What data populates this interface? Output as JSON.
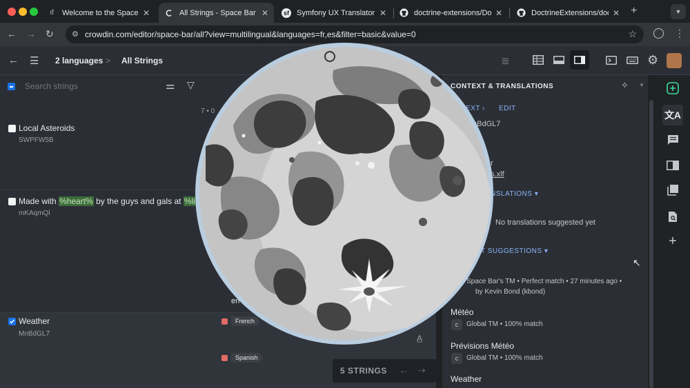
{
  "browser": {
    "tabs": [
      {
        "label": "Welcome to the SpaceBar",
        "favicon": "spacebar-logo-icon"
      },
      {
        "label": "All Strings - Space Bar - C",
        "favicon": "crowdin-icon",
        "active": true
      },
      {
        "label": "Symfony UX Translator Dc",
        "favicon": "symfony-icon"
      },
      {
        "label": "doctrine-extensions/Doct",
        "favicon": "github-icon"
      },
      {
        "label": "DoctrineExtensions/doc/t",
        "favicon": "github-icon"
      }
    ],
    "url": "crowdin.com/editor/space-bar/all?view=multilingual&languages=fr,es&filter=basic&value=0"
  },
  "header": {
    "languages": "2 languages",
    "separator": ">",
    "section": "All Strings"
  },
  "left_panel": {
    "search_placeholder": "Search strings",
    "pagination": "7 • 0",
    "strings": [
      {
        "text": "Local Asteroids",
        "id": "SWPFW5B",
        "checked": false
      },
      {
        "text_before": "Made with ",
        "hl1": "%heart%",
        "text_middle": " by the guys and gals at ",
        "hl2": "%link%",
        "id": "mKAqmQl",
        "checked": false
      },
      {
        "text": "Weather",
        "id": "MnBdGL7",
        "checked": true
      }
    ],
    "partial_text": "en",
    "languages": [
      "French",
      "Spanish"
    ],
    "strings_count": "5 STRINGS"
  },
  "right_panel": {
    "title": "CONTEXT & TRANSLATIONS",
    "context_tab": "EXT",
    "edit_link": "EDIT",
    "string_id": "nBdGL7",
    "file_label": "er",
    "file_name": "es.xlf",
    "translations_heading": "NSLATIONS",
    "no_translations": "No translations suggested yet",
    "suggestions_heading": "T SUGGESTIONS",
    "suggestions": [
      {
        "source": "Space Bar's TM",
        "match": "Perfect match",
        "time": "27 minutes ago",
        "author": "by Kevin Bond (kbond)"
      },
      {
        "text": "Météo",
        "source": "Global TM",
        "match": "100% match"
      },
      {
        "text": "Prévisions Météo",
        "source": "Global TM",
        "match": "100% match"
      },
      {
        "text": "Weather"
      }
    ]
  },
  "colors": {
    "accent": "#8ab4f8",
    "highlight_bg": "#3d6b3a",
    "active_sidebar_icon": "#3ddc97"
  }
}
